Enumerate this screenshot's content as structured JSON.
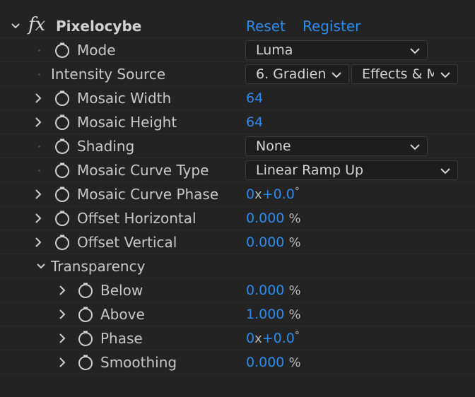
{
  "effect": {
    "name": "Pixelocybe",
    "fx_glyph": "fx",
    "reset_label": "Reset",
    "register_label": "Register"
  },
  "params": {
    "mode": {
      "label": "Mode",
      "value": "Luma"
    },
    "intensity_source": {
      "label": "Intensity Source",
      "layer_value": "6. Gradien",
      "source_value": "Effects & M"
    },
    "mosaic_width": {
      "label": "Mosaic Width",
      "value": "64"
    },
    "mosaic_height": {
      "label": "Mosaic Height",
      "value": "64"
    },
    "shading": {
      "label": "Shading",
      "value": "None"
    },
    "mosaic_curve_type": {
      "label": "Mosaic Curve Type",
      "value": "Linear Ramp Up"
    },
    "mosaic_curve_phase": {
      "label": "Mosaic Curve Phase",
      "rev": "0",
      "x": "x",
      "deg": "+0.0",
      "unit": "°"
    },
    "offset_horizontal": {
      "label": "Offset Horizontal",
      "value": "0.000",
      "unit": "%"
    },
    "offset_vertical": {
      "label": "Offset Vertical",
      "value": "0.000",
      "unit": "%"
    }
  },
  "transparency": {
    "label": "Transparency",
    "below": {
      "label": "Below",
      "value": "0.000",
      "unit": "%"
    },
    "above": {
      "label": "Above",
      "value": "1.000",
      "unit": "%"
    },
    "phase": {
      "label": "Phase",
      "rev": "0",
      "x": "x",
      "deg": "+0.0",
      "unit": "°"
    },
    "smoothing": {
      "label": "Smoothing",
      "value": "0.000",
      "unit": "%"
    }
  },
  "colors": {
    "background": "#232323",
    "value_blue": "#2d8ceb",
    "label_gray": "#c8c8c8"
  }
}
